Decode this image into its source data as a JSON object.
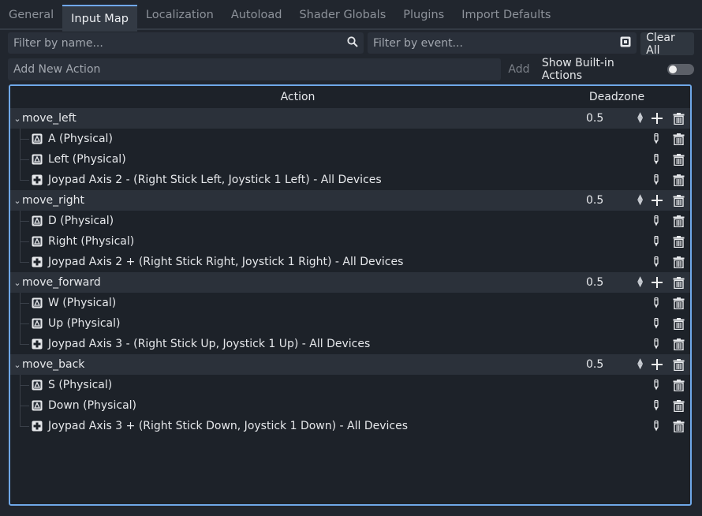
{
  "tabs": [
    {
      "label": "General",
      "active": false
    },
    {
      "label": "Input Map",
      "active": true
    },
    {
      "label": "Localization",
      "active": false
    },
    {
      "label": "Autoload",
      "active": false
    },
    {
      "label": "Shader Globals",
      "active": false
    },
    {
      "label": "Plugins",
      "active": false
    },
    {
      "label": "Import Defaults",
      "active": false
    }
  ],
  "filter": {
    "name_placeholder": "Filter by name...",
    "event_placeholder": "Filter by event...",
    "clear_all_label": "Clear All"
  },
  "add_row": {
    "new_action_placeholder": "Add New Action",
    "add_label": "Add",
    "show_builtin_label": "Show Built-in Actions",
    "show_builtin_on": false
  },
  "table": {
    "col_action": "Action",
    "col_deadzone": "Deadzone"
  },
  "actions": [
    {
      "name": "move_left",
      "deadzone": "0.5",
      "events": [
        {
          "type": "key",
          "label": "A (Physical)"
        },
        {
          "type": "key",
          "label": "Left (Physical)"
        },
        {
          "type": "joypad",
          "label": "Joypad Axis 2 - (Right Stick Left, Joystick 1 Left) - All Devices"
        }
      ]
    },
    {
      "name": "move_right",
      "deadzone": "0.5",
      "events": [
        {
          "type": "key",
          "label": "D (Physical)"
        },
        {
          "type": "key",
          "label": "Right (Physical)"
        },
        {
          "type": "joypad",
          "label": "Joypad Axis 2 + (Right Stick Right, Joystick 1 Right) - All Devices"
        }
      ]
    },
    {
      "name": "move_forward",
      "deadzone": "0.5",
      "events": [
        {
          "type": "key",
          "label": "W (Physical)"
        },
        {
          "type": "key",
          "label": "Up (Physical)"
        },
        {
          "type": "joypad",
          "label": "Joypad Axis 3 - (Right Stick Up, Joystick 1 Up) - All Devices"
        }
      ]
    },
    {
      "name": "move_back",
      "deadzone": "0.5",
      "events": [
        {
          "type": "key",
          "label": "S (Physical)"
        },
        {
          "type": "key",
          "label": "Down (Physical)"
        },
        {
          "type": "joypad",
          "label": "Joypad Axis 3 + (Right Stick Down, Joystick 1 Down) - All Devices"
        }
      ]
    }
  ],
  "colors": {
    "accent": "#70a8ff",
    "tree_border": "#6fa8e8",
    "background": "#21262e",
    "action_row": "#2b313a"
  }
}
